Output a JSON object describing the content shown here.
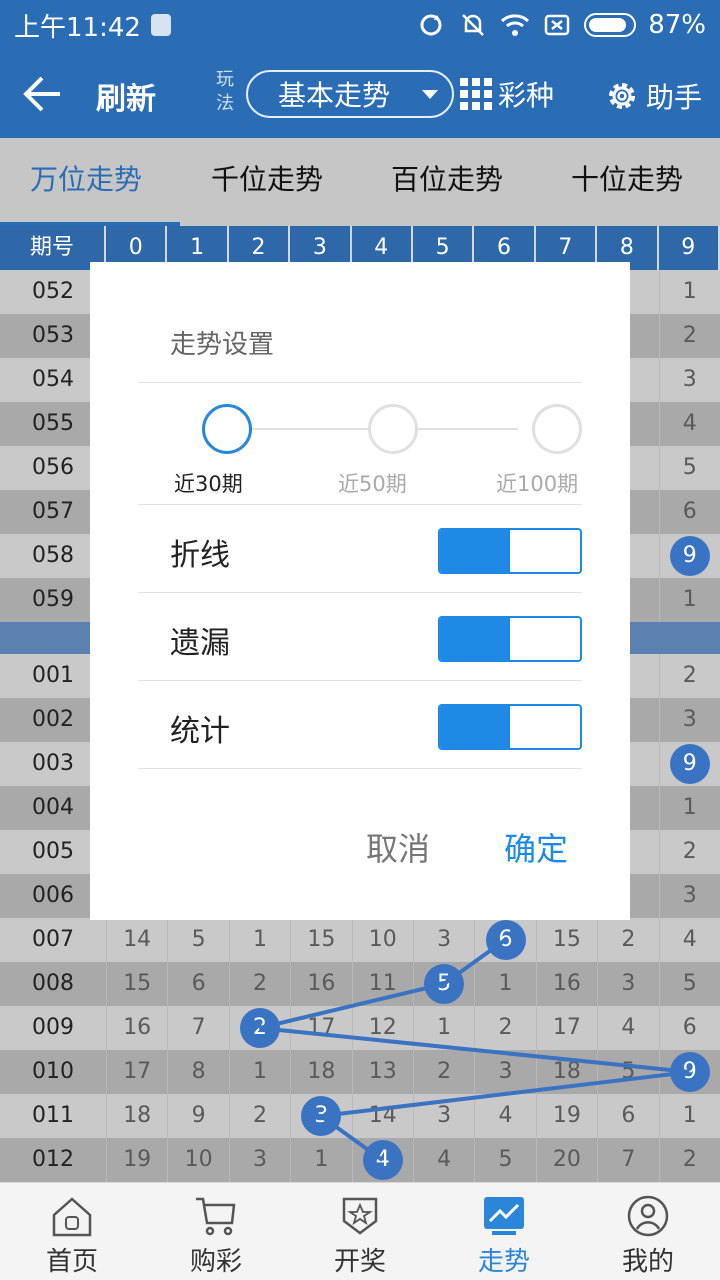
{
  "status_bar": {
    "time": "上午11:42",
    "battery": "87%",
    "battery_level": 0.87
  },
  "app_bar": {
    "refresh_label": "刷新",
    "play_label": "玩法",
    "play_selected": "基本走势",
    "lottery_label": "彩种",
    "helper_label": "助手"
  },
  "tabs": [
    {
      "label": "万位走势",
      "active": true
    },
    {
      "label": "千位走势",
      "active": false
    },
    {
      "label": "百位走势",
      "active": false
    },
    {
      "label": "十位走势",
      "active": false
    }
  ],
  "table": {
    "header": [
      "期号",
      "0",
      "1",
      "2",
      "3",
      "4",
      "5",
      "6",
      "7",
      "8",
      "9"
    ],
    "top_rows": [
      {
        "period": "052",
        "visible": [
          {
            "col": 9,
            "text": "1"
          }
        ]
      },
      {
        "period": "053",
        "visible": [
          {
            "col": 9,
            "text": "2"
          }
        ]
      },
      {
        "period": "054",
        "visible": [
          {
            "col": 9,
            "text": "3"
          }
        ]
      },
      {
        "period": "055",
        "visible": [
          {
            "col": 9,
            "text": "4"
          }
        ]
      },
      {
        "period": "056",
        "visible": [
          {
            "col": 9,
            "text": "5"
          }
        ]
      },
      {
        "period": "057",
        "visible": [
          {
            "col": 9,
            "text": "6"
          }
        ]
      },
      {
        "period": "058",
        "visible": [],
        "hit_col": 9,
        "hit": "9"
      },
      {
        "period": "059",
        "visible": [
          {
            "col": 9,
            "text": "1"
          }
        ]
      }
    ],
    "bottom_rows": [
      {
        "period": "001",
        "visible": [
          {
            "col": 9,
            "text": "2"
          }
        ]
      },
      {
        "period": "002",
        "visible": [
          {
            "col": 9,
            "text": "3"
          }
        ]
      },
      {
        "period": "003",
        "visible": [],
        "hit_col": 9,
        "hit": "9"
      },
      {
        "period": "004",
        "visible": [
          {
            "col": 9,
            "text": "1"
          }
        ]
      },
      {
        "period": "005",
        "visible": [
          {
            "col": 9,
            "text": "2"
          }
        ]
      },
      {
        "period": "006",
        "visible": [
          {
            "col": 9,
            "text": "3"
          }
        ]
      },
      {
        "period": "007",
        "cells": [
          "14",
          "5",
          "1",
          "15",
          "10",
          "3",
          "6",
          "15",
          "2",
          "4"
        ],
        "hit_col": 6
      },
      {
        "period": "008",
        "cells": [
          "15",
          "6",
          "2",
          "16",
          "11",
          "5",
          "1",
          "16",
          "3",
          "5"
        ],
        "hit_col": 5
      },
      {
        "period": "009",
        "cells": [
          "16",
          "7",
          "2",
          "17",
          "12",
          "1",
          "2",
          "17",
          "4",
          "6"
        ],
        "hit_col": 2
      },
      {
        "period": "010",
        "cells": [
          "17",
          "8",
          "1",
          "18",
          "13",
          "2",
          "3",
          "18",
          "5",
          "9"
        ],
        "hit_col": 9
      },
      {
        "period": "011",
        "cells": [
          "18",
          "9",
          "2",
          "3",
          "14",
          "3",
          "4",
          "19",
          "6",
          "1"
        ],
        "hit_col": 3
      },
      {
        "period": "012",
        "cells": [
          "19",
          "10",
          "3",
          "1",
          "4",
          "4",
          "5",
          "20",
          "7",
          "2"
        ],
        "hit_col": 4
      }
    ]
  },
  "dialog": {
    "title": "走势设置",
    "ranges": [
      "近30期",
      "近50期",
      "近100期"
    ],
    "selected_range": 0,
    "options": [
      {
        "label": "折线",
        "enabled": true
      },
      {
        "label": "遗漏",
        "enabled": true
      },
      {
        "label": "统计",
        "enabled": true
      }
    ],
    "cancel": "取消",
    "confirm": "确定"
  },
  "bottom_nav": [
    {
      "label": "首页",
      "icon": "home-icon",
      "active": false
    },
    {
      "label": "购彩",
      "icon": "cart-icon",
      "active": false
    },
    {
      "label": "开奖",
      "icon": "trophy-badge-icon",
      "active": false
    },
    {
      "label": "走势",
      "icon": "trend-chart-icon",
      "active": true
    },
    {
      "label": "我的",
      "icon": "user-icon",
      "active": false
    }
  ],
  "colors": {
    "primary": "#2a6db5",
    "accent": "#1e8ae6",
    "hit_ball": "#3a73c1"
  }
}
